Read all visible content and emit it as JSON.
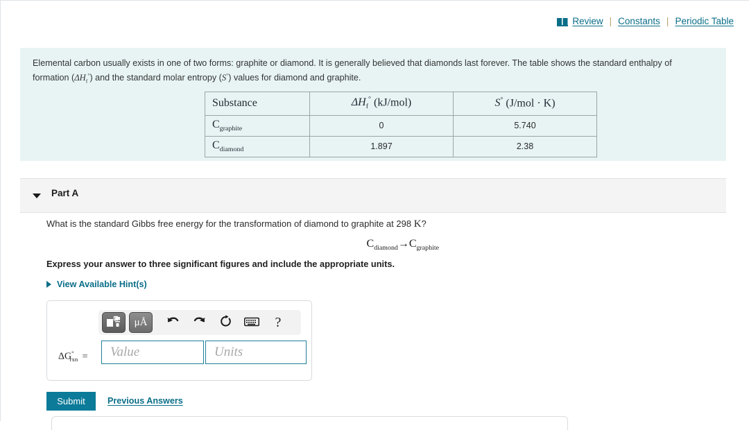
{
  "header": {
    "book_icon": "book-icon",
    "links": [
      {
        "label": "Review",
        "name": "review-link"
      },
      {
        "label": "Constants",
        "name": "constants-link"
      },
      {
        "label": "Periodic Table",
        "name": "periodic-table-link"
      }
    ],
    "separator": "|"
  },
  "intro": {
    "line1_a": "Elemental carbon usually exists in one of two forms: graphite or diamond. It is generally believed that diamonds last forever. The table shows the standard enthalpy of",
    "line2_a": "formation (",
    "delta_h_symbol": "ΔH",
    "delta_h_sub": "f",
    "delta_h_sup": "°",
    "line2_b": ") and the standard molar entropy (",
    "s_symbol": "S",
    "s_sup": "°",
    "line2_c": ") values for diamond and graphite."
  },
  "table": {
    "headers": {
      "substance": "Substance",
      "enthalpy_symbol": "ΔH",
      "enthalpy_sub": "f",
      "enthalpy_sup": "°",
      "enthalpy_units": "(kJ/mol)",
      "entropy_symbol": "S",
      "entropy_sup": "°",
      "entropy_units": "(J/mol · K)"
    },
    "rows": [
      {
        "substance_symbol": "C",
        "substance_sub": "graphite",
        "enthalpy": "0",
        "entropy": "5.740"
      },
      {
        "substance_symbol": "C",
        "substance_sub": "diamond",
        "enthalpy": "1.897",
        "entropy": "2.38"
      }
    ]
  },
  "part": {
    "title": "Part A",
    "question_a": "What is the standard Gibbs free energy for the transformation of diamond to graphite at 298 ",
    "question_k": "K",
    "question_b": "?",
    "equation_c1": "C",
    "equation_sub1": "diamond",
    "equation_arrow": "→",
    "equation_c2": "C",
    "equation_sub2": "graphite",
    "instruction": "Express your answer to three significant figures and include the appropriate units.",
    "hints_label": "View Available Hint(s)"
  },
  "answer": {
    "toolbar": {
      "template_button": "math-template-icon",
      "units_button": "μÅ",
      "undo": "undo-icon",
      "redo": "redo-icon",
      "reset": "reset-icon",
      "keyboard": "keyboard-icon",
      "help": "?"
    },
    "label_delta": "ΔG",
    "label_sup": "°",
    "label_sub": "rxn",
    "label_equals": "=",
    "value_placeholder": "Value",
    "value_current": "",
    "units_placeholder": "Units",
    "units_current": ""
  },
  "actions": {
    "submit_label": "Submit",
    "previous_answers_label": "Previous Answers"
  },
  "colors": {
    "accent_teal": "#0b7b99",
    "link_teal": "#0a6e88",
    "panel_bg": "#e8f4f4",
    "band_bg": "#f4f4f4"
  }
}
